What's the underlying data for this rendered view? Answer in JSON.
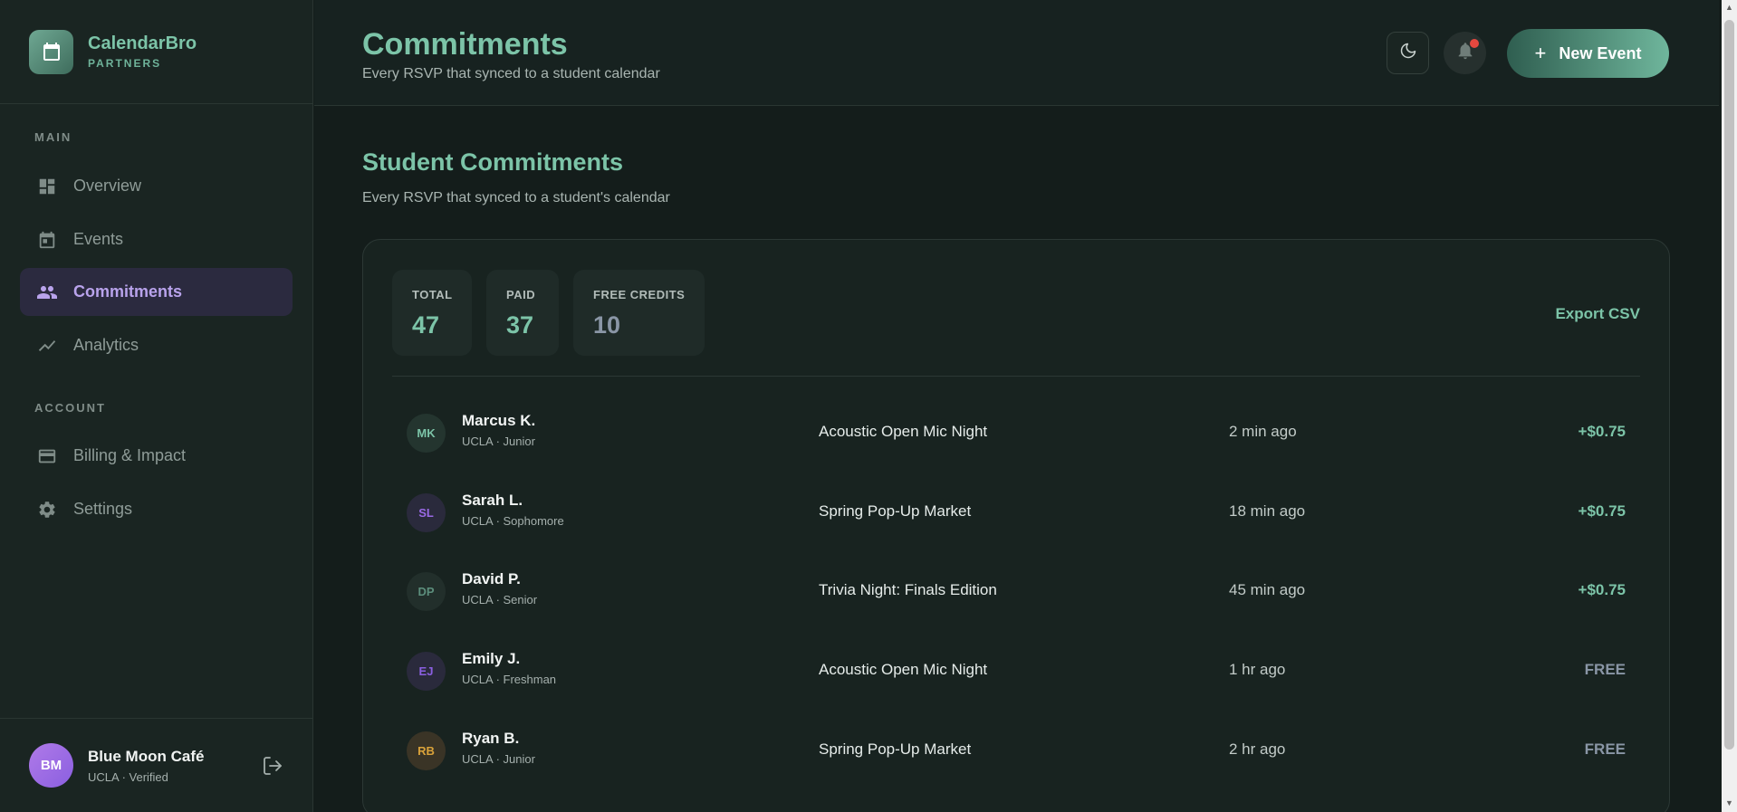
{
  "brand": {
    "name": "CalendarBro",
    "sub": "PARTNERS",
    "icon": "calendar-icon"
  },
  "nav": {
    "main_label": "MAIN",
    "account_label": "ACCOUNT",
    "items": [
      {
        "label": "Overview",
        "icon": "dashboard-icon",
        "active": false
      },
      {
        "label": "Events",
        "icon": "calendar-icon",
        "active": false
      },
      {
        "label": "Commitments",
        "icon": "people-icon",
        "active": true
      },
      {
        "label": "Analytics",
        "icon": "trend-icon",
        "active": false
      },
      {
        "label": "Billing & Impact",
        "icon": "credit-card-icon",
        "active": false
      },
      {
        "label": "Settings",
        "icon": "gear-icon",
        "active": false
      }
    ]
  },
  "user": {
    "initials": "BM",
    "name": "Blue Moon Café",
    "sub": "UCLA · Verified"
  },
  "header": {
    "title": "Commitments",
    "subtitle": "Every RSVP that synced to a student calendar",
    "new_event_label": "New Event"
  },
  "main": {
    "title": "Student Commitments",
    "subtitle": "Every RSVP that synced to a student's calendar",
    "export_label": "Export CSV",
    "stats": [
      {
        "label": "TOTAL",
        "value": "47",
        "color": "#7cc4a8"
      },
      {
        "label": "PAID",
        "value": "37",
        "color": "#7cc4a8"
      },
      {
        "label": "FREE CREDITS",
        "value": "10",
        "color": "#8a96a6"
      }
    ],
    "rows": [
      {
        "initials": "MK",
        "name": "Marcus K.",
        "meta": "UCLA · Junior",
        "event": "Acoustic Open Mic Night",
        "time": "2 min ago",
        "amount": "+$0.75",
        "avatar_bg": "#24352f",
        "avatar_fg": "#7cc4a8",
        "amount_color": "#7cc4a8"
      },
      {
        "initials": "SL",
        "name": "Sarah L.",
        "meta": "UCLA · Sophomore",
        "event": "Spring Pop-Up Market",
        "time": "18 min ago",
        "amount": "+$0.75",
        "avatar_bg": "#2a2a3c",
        "avatar_fg": "#9a6ae6",
        "amount_color": "#7cc4a8"
      },
      {
        "initials": "DP",
        "name": "David P.",
        "meta": "UCLA · Senior",
        "event": "Trivia Night: Finals Edition",
        "time": "45 min ago",
        "amount": "+$0.75",
        "avatar_bg": "#222f2b",
        "avatar_fg": "#5c8e7c",
        "amount_color": "#7cc4a8"
      },
      {
        "initials": "EJ",
        "name": "Emily J.",
        "meta": "UCLA · Freshman",
        "event": "Acoustic Open Mic Night",
        "time": "1 hr ago",
        "amount": "FREE",
        "avatar_bg": "#2a2a3c",
        "avatar_fg": "#8a5fe0",
        "amount_color": "#8a96a6"
      },
      {
        "initials": "RB",
        "name": "Ryan B.",
        "meta": "UCLA · Junior",
        "event": "Spring Pop-Up Market",
        "time": "2 hr ago",
        "amount": "FREE",
        "avatar_bg": "#3a3426",
        "avatar_fg": "#d9a23a",
        "amount_color": "#8a96a6"
      }
    ]
  }
}
